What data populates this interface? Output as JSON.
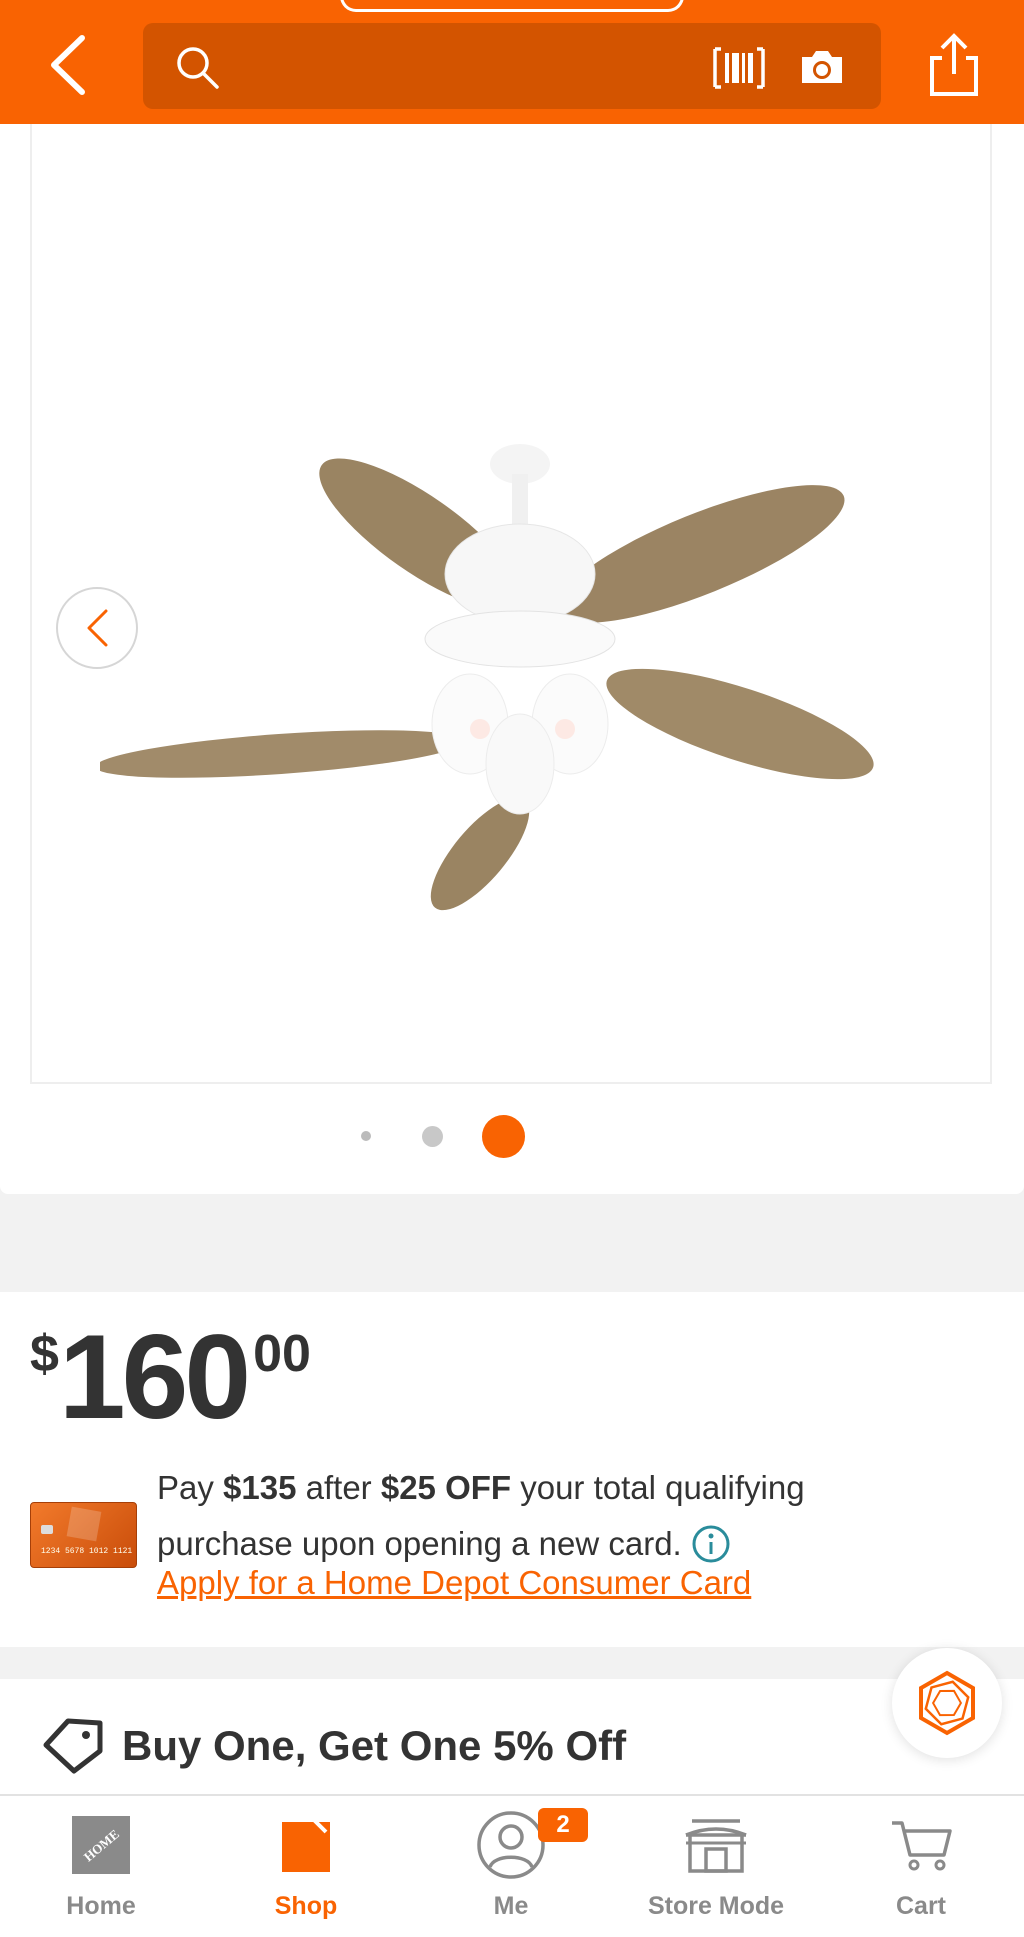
{
  "header": {
    "search_placeholder": ""
  },
  "gallery": {
    "image_alt": "White ceiling fan with five wood-tone blades and light kit",
    "current_index": 3,
    "total": 3
  },
  "price": {
    "dollar_sign": "$",
    "whole": "160",
    "cents": "00"
  },
  "offer": {
    "pay_prefix": "Pay ",
    "pay_amount": "$135",
    "after": " after ",
    "discount": "$25 OFF",
    "line1_suffix": " your total qualifying",
    "line2": "purchase upon opening a new card.",
    "apply_link": "Apply for a Home Depot Consumer Card"
  },
  "promo": {
    "title": "Buy One, Get One 5% Off"
  },
  "nav": {
    "home": "Home",
    "shop": "Shop",
    "me": "Me",
    "me_badge": "2",
    "store_mode": "Store Mode",
    "cart": "Cart"
  },
  "colors": {
    "brand": "#f96302",
    "search_bg": "#d35400",
    "text": "#333333",
    "inactive": "#8a8a8a"
  }
}
